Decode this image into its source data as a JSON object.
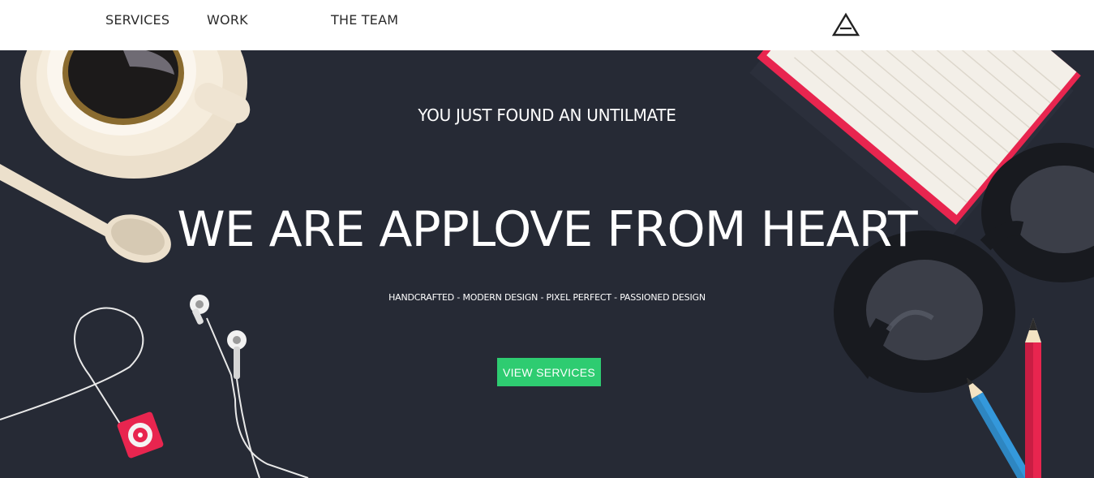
{
  "nav": {
    "items": [
      {
        "label": "SERVICES"
      },
      {
        "label": "WORK"
      },
      {
        "label": "THE TEAM"
      }
    ]
  },
  "logo": {
    "icon": "triangle-logo-icon"
  },
  "hero": {
    "intro": "YOU JUST FOUND AN UNTILMATE",
    "headline": "WE ARE APPLOVE FROM HEART",
    "tagline": "HANDCRAFTED - MODERN DESIGN - PIXEL PERFECT - PASSIONED DESIGN",
    "cta_label": "VIEW SERVICES"
  },
  "colors": {
    "hero_background": "#262a35",
    "accent": "#2ecc71",
    "nav_text": "#2b2b2b",
    "highlight_red": "#e8254f"
  },
  "decor_icons": [
    "coffee-cup-icon",
    "spoon-icon",
    "earphones-icon",
    "music-player-icon",
    "notebook-icon",
    "glasses-icon",
    "pencil-icon"
  ]
}
